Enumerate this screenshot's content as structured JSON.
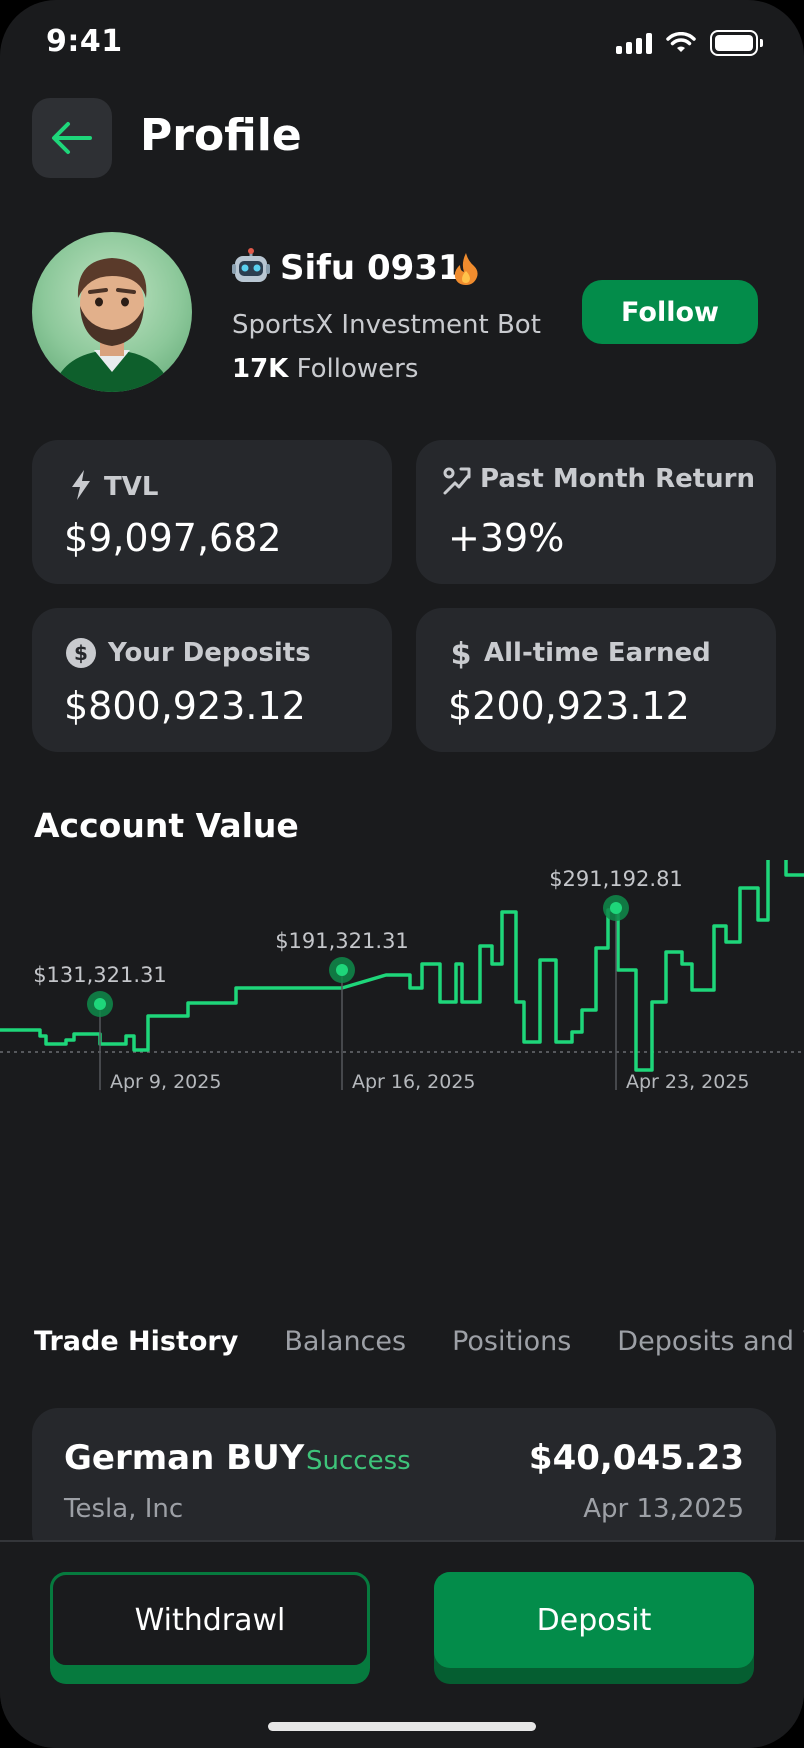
{
  "status_bar": {
    "time": "9:41"
  },
  "header": {
    "title": "Profile"
  },
  "profile": {
    "name": "Sifu 0931",
    "subtitle": "SportsX Investment Bot",
    "followers_count": "17K",
    "followers_label": "Followers",
    "follow_label": "Follow"
  },
  "stats": [
    {
      "label": "TVL",
      "value": "$9,097,682",
      "icon": "lightning-icon"
    },
    {
      "label": "Past Month Return",
      "value": "+39%",
      "icon": "percent-arrow-icon"
    },
    {
      "label": "Your Deposits",
      "value": "$800,923.12",
      "icon": "dollar-circle-icon"
    },
    {
      "label": "All-time Earned",
      "value": "$200,923.12",
      "icon": "dollar-icon"
    }
  ],
  "chart_title": "Account Value",
  "chart_data": {
    "type": "line",
    "title": "Account Value",
    "color": "#1ed67a",
    "annotations": [
      {
        "label": "$131,321.31",
        "date": "Apr 9, 2025"
      },
      {
        "label": "$191,321.31",
        "date": "Apr 16, 2025"
      },
      {
        "label": "$291,192.81",
        "date": "Apr 23, 2025"
      }
    ]
  },
  "tabs": [
    "Trade History",
    "Balances",
    "Positions",
    "Deposits and Withdrawals"
  ],
  "trade": {
    "title": "German BUY",
    "status": "Success",
    "amount": "$40,045.23",
    "company": "Tesla, Inc",
    "date": "Apr 13,2025"
  },
  "actions": {
    "withdraw": "Withdrawl",
    "deposit": "Deposit"
  },
  "colors": {
    "accent": "#038c4a",
    "line": "#1ed67a",
    "background": "#1a1b1d",
    "card": "#26282c"
  }
}
